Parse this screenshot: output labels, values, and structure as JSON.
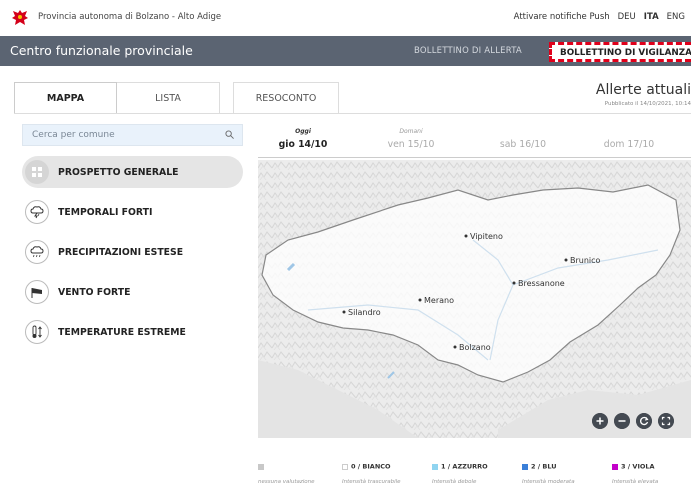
{
  "topbar": {
    "province": "Provincia autonoma di Bolzano - Alto Adige",
    "push": "Attivare notifiche Push",
    "langs": [
      "DEU",
      "ITA",
      "ENG"
    ]
  },
  "nav": {
    "title": "Centro funzionale provinciale",
    "links": [
      "BOLLETTINO DI ALLERTA",
      "BOLLETTINO DI VIGILANZA"
    ]
  },
  "tabs": [
    "MAPPA",
    "LISTA",
    "RESOCONTO"
  ],
  "alerts": {
    "title": "Allerte attuali",
    "published": "Pubblicato il 14/10/2021, 10:14"
  },
  "search": {
    "placeholder": "Cerca per comune"
  },
  "sidebar": {
    "items": [
      {
        "label": "PROSPETTO GENERALE",
        "icon": "grid-icon"
      },
      {
        "label": "TEMPORALI FORTI",
        "icon": "thunderstorm-icon"
      },
      {
        "label": "PRECIPITAZIONI ESTESE",
        "icon": "rain-cloud-icon"
      },
      {
        "label": "VENTO FORTE",
        "icon": "wind-icon"
      },
      {
        "label": "TEMPERATURE ESTREME",
        "icon": "thermometer-icon"
      }
    ]
  },
  "days": [
    {
      "top": "Oggi",
      "label": "gio 14/10"
    },
    {
      "top": "Domani",
      "label": "ven 15/10"
    },
    {
      "top": "",
      "label": "sab 16/10"
    },
    {
      "top": "",
      "label": "dom 17/10"
    }
  ],
  "map": {
    "cities": [
      "Vipiteno",
      "Brunico",
      "Bressanone",
      "Merano",
      "Silandro",
      "Bolzano"
    ]
  },
  "legend": [
    {
      "label": "",
      "desc": "nessuna valutazione",
      "color": "#c8c8c8"
    },
    {
      "label": "0 / BIANCO",
      "desc": "Intensità trascurabile",
      "color": "#ffffff"
    },
    {
      "label": "1 / AZZURRO",
      "desc": "Intensità debole",
      "color": "#8fd4f0"
    },
    {
      "label": "2 / BLU",
      "desc": "Intensità moderata",
      "color": "#3a7fd8"
    },
    {
      "label": "3 / VIOLA",
      "desc": "Intensità elevata",
      "color": "#c300c9"
    }
  ],
  "colors": {
    "navbar": "#5b6472",
    "highlight": "#e0001b",
    "search": "#e9f2fb"
  }
}
